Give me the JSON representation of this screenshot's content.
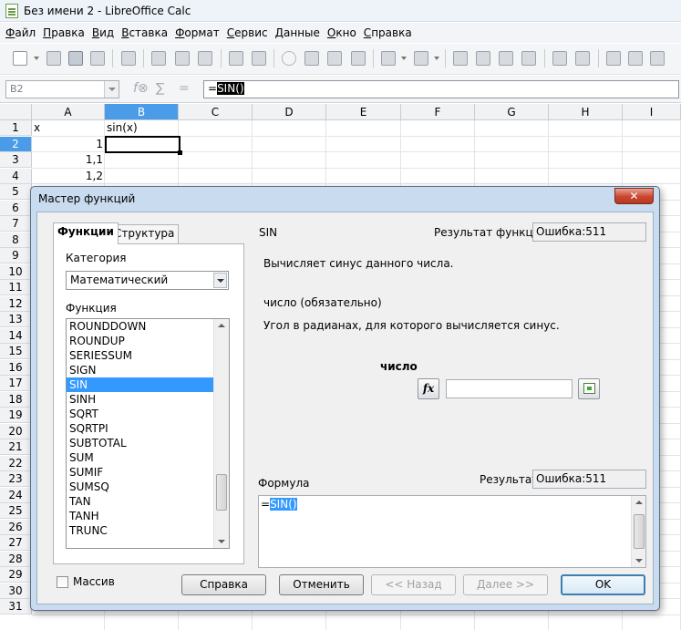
{
  "window": {
    "title": "Без имени 2 - LibreOffice Calc"
  },
  "menu": [
    "Файл",
    "Правка",
    "Вид",
    "Вставка",
    "Формат",
    "Сервис",
    "Данные",
    "Окно",
    "Справка"
  ],
  "formula_bar": {
    "name_box": "B2",
    "formula_text": "=SIN()",
    "prefix": "=",
    "func_part": "SIN()"
  },
  "sheet": {
    "columns": [
      "A",
      "B",
      "C",
      "D",
      "E",
      "F",
      "G",
      "H",
      "I"
    ],
    "active_column": "B",
    "rows": [
      "1",
      "2",
      "3",
      "4",
      "5",
      "6",
      "7",
      "8",
      "9",
      "10",
      "11",
      "12",
      "13",
      "14",
      "15",
      "16",
      "17",
      "18",
      "19",
      "20",
      "21",
      "22",
      "23",
      "24",
      "25",
      "26",
      "27",
      "28",
      "29",
      "30",
      "31"
    ],
    "active_row": "2",
    "cells": {
      "A1": "x",
      "B1": "sin(x)",
      "A2": "1",
      "A3": "1,1",
      "A4": "1,2"
    }
  },
  "dialog": {
    "title": "Мастер функций",
    "close_glyph": "✕",
    "tabs": [
      "Функции",
      "Структура"
    ],
    "category_label": "Категория",
    "category_value": "Математический",
    "function_label": "Функция",
    "functions": [
      "ROUNDDOWN",
      "ROUNDUP",
      "SERIESSUM",
      "SIGN",
      "SIN",
      "SINH",
      "SQRT",
      "SQRTPI",
      "SUBTOTAL",
      "SUM",
      "SUMIF",
      "SUMSQ",
      "TAN",
      "TANH",
      "TRUNC"
    ],
    "selected_function": "SIN",
    "list_scroll_position": 0.85,
    "function_name": "SIN",
    "result_label": "Результат функции",
    "result_value": "Ошибка:511",
    "description": "Вычисляет синус данного числа.",
    "arg_title": "число (обязательно)",
    "arg_description": "Угол в радианах, для которого вычисляется синус.",
    "arg_label": "число",
    "fx_glyph": "fx",
    "arg_value": "",
    "formula_label": "Формула",
    "formula_result_label": "Результат",
    "formula_result_value": "Ошибка:511",
    "formula_prefix": "=",
    "formula_func": "SIN()",
    "array_checkbox_label": "Массив",
    "array_checked": false,
    "buttons": {
      "help": "Справка",
      "cancel": "Отменить",
      "back": "<< Назад",
      "next": "Далее >>",
      "ok": "OK"
    }
  }
}
